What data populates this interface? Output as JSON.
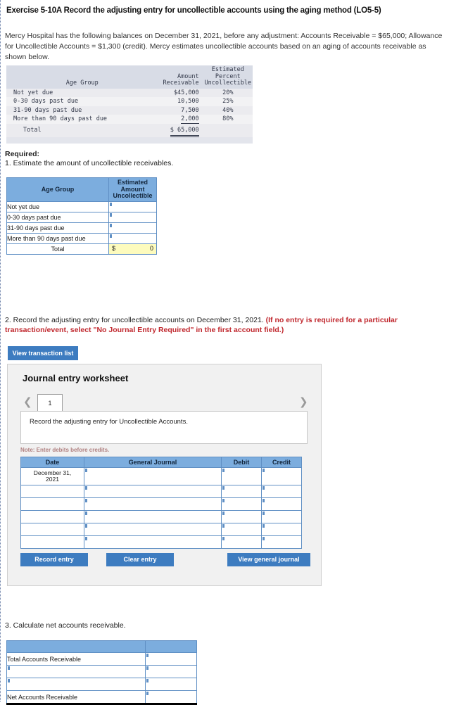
{
  "exercise": {
    "title": "Exercise 5-10A Record the adjusting entry for uncollectible accounts using the aging method (LO5-5)",
    "intro": "Mercy Hospital has the following balances on December 31, 2021, before any adjustment: Accounts Receivable = $65,000; Allowance for Uncollectible Accounts = $1,300 (credit). Mercy estimates uncollectible accounts based on an aging of accounts receivable as shown below."
  },
  "aging_table": {
    "headers": {
      "age_group": "Age Group",
      "amount_receivable": "Amount Receivable",
      "estimated_percent_line1": "Estimated",
      "estimated_percent_line2": "Percent",
      "estimated_percent_line3": "Uncollectible"
    },
    "rows": [
      {
        "age_group": "Not yet due",
        "amount": "$45,000",
        "percent": "20%"
      },
      {
        "age_group": "0-30 days past due",
        "amount": "10,500",
        "percent": "25%"
      },
      {
        "age_group": "31-90 days past due",
        "amount": "7,500",
        "percent": "40%"
      },
      {
        "age_group": "More than 90 days past due",
        "amount": "2,000",
        "percent": "80%"
      }
    ],
    "total_label": "Total",
    "total_amount": "$ 65,000"
  },
  "required": {
    "label": "Required:",
    "item1": "1. Estimate the amount of uncollectible receivables.",
    "item2_black": "2. Record the adjusting entry for uncollectible accounts on December 31, 2021. ",
    "item2_red": "(If no entry is required for a particular transaction/event, select \"No Journal Entry Required\" in the first account field.)",
    "item3": "3. Calculate net accounts receivable."
  },
  "estimate_table": {
    "header_age_group": "Age Group",
    "header_estimated_line1": "Estimated",
    "header_estimated_line2": "Amount",
    "header_estimated_line3": "Uncollectible",
    "rows": [
      {
        "label": "Not yet due",
        "value": ""
      },
      {
        "label": "0-30 days past due",
        "value": ""
      },
      {
        "label": "31-90 days past due",
        "value": ""
      },
      {
        "label": "More than 90 days past due",
        "value": ""
      }
    ],
    "total_label": "Total",
    "total_dollar": "$",
    "total_value": "0"
  },
  "buttons": {
    "view_transaction_list": "View transaction list",
    "record_entry": "Record entry",
    "clear_entry": "Clear entry",
    "view_general_journal": "View general journal"
  },
  "worksheet": {
    "title": "Journal entry worksheet",
    "tab_number": "1",
    "prev_icon": "chevron-left-icon",
    "next_icon": "chevron-right-icon",
    "description": "Record the adjusting entry for Uncollectible Accounts.",
    "note": "Note: Enter debits before credits.",
    "columns": {
      "date": "Date",
      "general_journal": "General Journal",
      "debit": "Debit",
      "credit": "Credit"
    },
    "rows": [
      {
        "date_line1": "December 31,",
        "date_line2": "2021",
        "journal": "",
        "debit": "",
        "credit": ""
      },
      {
        "date_line1": "",
        "date_line2": "",
        "journal": "",
        "debit": "",
        "credit": ""
      },
      {
        "date_line1": "",
        "date_line2": "",
        "journal": "",
        "debit": "",
        "credit": ""
      },
      {
        "date_line1": "",
        "date_line2": "",
        "journal": "",
        "debit": "",
        "credit": ""
      },
      {
        "date_line1": "",
        "date_line2": "",
        "journal": "",
        "debit": "",
        "credit": ""
      },
      {
        "date_line1": "",
        "date_line2": "",
        "journal": "",
        "debit": "",
        "credit": ""
      }
    ]
  },
  "net_receivable_table": {
    "header_a": "",
    "header_b": "",
    "rows": [
      {
        "label": "Total Accounts Receivable",
        "value": "",
        "input_label": false
      },
      {
        "label": "",
        "value": "",
        "input_label": true
      },
      {
        "label": "",
        "value": "",
        "input_label": true
      },
      {
        "label": "Net Accounts Receivable",
        "value": "",
        "input_label": false
      }
    ]
  },
  "colors": {
    "accent_blue": "#3d7cc0",
    "table_header_blue": "#7cadde",
    "table_border_blue": "#5f8fc4",
    "total_yellow": "#fdfbbd",
    "red_text": "#c0272d"
  }
}
